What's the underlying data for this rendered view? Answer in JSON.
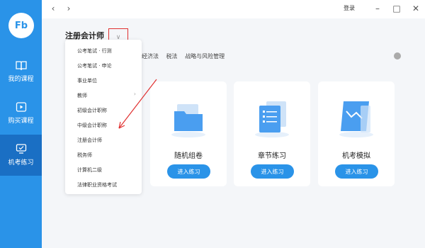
{
  "app": {
    "logo_text": "Fb"
  },
  "sidebar": {
    "items": [
      {
        "label": "我的课程",
        "icon": "book-icon",
        "active": false
      },
      {
        "label": "购买课程",
        "icon": "play-icon",
        "active": false
      },
      {
        "label": "机考练习",
        "icon": "monitor-icon",
        "active": true
      }
    ]
  },
  "titlebar": {
    "login_label": "登录",
    "icons": [
      "back-icon",
      "forward-icon",
      "minimize-icon",
      "maximize-icon",
      "close-icon"
    ]
  },
  "header": {
    "exam_title": "注册会计师",
    "dropdown_icon": "chevron-down-icon"
  },
  "subject_tabs": [
    "经济法",
    "税法",
    "战略与风险管理"
  ],
  "dropdown": {
    "items": [
      {
        "label": "公考笔试 · 行测",
        "has_submenu": false
      },
      {
        "label": "公考笔试 · 申论",
        "has_submenu": false
      },
      {
        "label": "事业单位",
        "has_submenu": false
      },
      {
        "label": "教师",
        "has_submenu": true
      },
      {
        "label": "初级会计职称",
        "has_submenu": false
      },
      {
        "label": "中级会计职称",
        "has_submenu": false
      },
      {
        "label": "注册会计师",
        "has_submenu": false
      },
      {
        "label": "税务师",
        "has_submenu": false
      },
      {
        "label": "计算机二级",
        "has_submenu": false
      },
      {
        "label": "法律职业资格考试",
        "has_submenu": false
      }
    ]
  },
  "cards": [
    {
      "label": "随机组卷",
      "button": "进入练习",
      "icon": "folder-icon"
    },
    {
      "label": "章节练习",
      "button": "进入练习",
      "icon": "document-stack-icon"
    },
    {
      "label": "机考模拟",
      "button": "进入练习",
      "icon": "chart-doc-icon"
    }
  ],
  "annotation": {
    "color": "#e03030"
  },
  "colors": {
    "accent": "#2a93e8",
    "sidebar_active": "#1a6fc4",
    "annotation_red": "#e03030"
  }
}
